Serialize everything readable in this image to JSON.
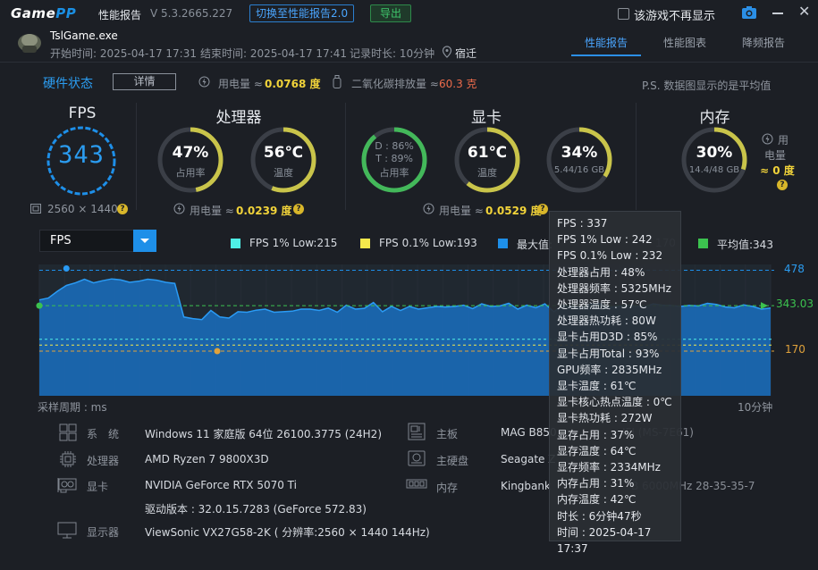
{
  "titlebar": {
    "logo_a": "Game",
    "logo_b": "PP",
    "section_title": "性能报告",
    "version": "V 5.3.2665.227",
    "switch_button": "切换至性能报告2.0",
    "export_button": "导出",
    "no_show_label": "该游戏不再显示"
  },
  "session": {
    "game_name": "TslGame.exe",
    "start": "开始时间: 2025-04-17 17:31",
    "end": "结束时间: 2025-04-17 17:41",
    "duration": "记录时长: 10分钟",
    "location": "宿迁"
  },
  "tabs": [
    {
      "label": "性能报告",
      "active": true
    },
    {
      "label": "性能图表",
      "active": false
    },
    {
      "label": "降频报告",
      "active": false
    }
  ],
  "hardware_status": {
    "title": "硬件状态",
    "detail_button": "详情",
    "power_label": "用电量 ≈",
    "power_value": "0.0768 度",
    "co2_label": "二氧化碳排放量 ≈",
    "co2_value": "60.3 克",
    "note": "P.S. 数据图显示的是平均值"
  },
  "fps_card": {
    "title": "FPS",
    "value": "343",
    "resolution": "2560 × 1440",
    "fraction": 0.97
  },
  "cpu_card": {
    "title": "处理器",
    "usage_value": "47%",
    "usage_label": "占用率",
    "usage_fraction": 0.47,
    "temp_value": "56℃",
    "temp_label": "温度",
    "temp_fraction": 0.56,
    "power_label": "用电量 ≈",
    "power_value": "0.0239 度"
  },
  "gpu_card": {
    "title": "显卡",
    "d_line": "D : 86%",
    "t_line": "T : 89%",
    "usage_label": "占用率",
    "usage_fraction": 0.89,
    "temp_value": "61℃",
    "temp_label": "温度",
    "temp_fraction": 0.61,
    "mem_value": "34%",
    "mem_sub": "5.44/16 GB",
    "mem_fraction": 0.34,
    "power_label": "用电量 ≈",
    "power_value": "0.0529 度"
  },
  "memory_card": {
    "title": "内存",
    "value": "30%",
    "sub": "14.4/48 GB",
    "fraction": 0.3,
    "power_label_1": "用",
    "power_label_2": "电量",
    "power_value": "≈ 0 度"
  },
  "chart_controls": {
    "metric_select": "FPS",
    "legend": [
      {
        "label": "FPS 1% Low:215",
        "color": "#4ff0e6"
      },
      {
        "label": "FPS 0.1% Low:193",
        "color": "#f5e94c"
      },
      {
        "label": "最大值:",
        "color": "#1e8fe8"
      },
      {
        "label": "170",
        "color": ""
      },
      {
        "label": "平均值:343",
        "color": "#3cc24f"
      }
    ]
  },
  "chart_data": {
    "type": "area",
    "series": [
      {
        "name": "FPS",
        "values": [
          365,
          372,
          398,
          420,
          430,
          444,
          430,
          438,
          445,
          441,
          432,
          436,
          444,
          440,
          432,
          428,
          300,
          294,
          290,
          325,
          300,
          296,
          320,
          318,
          326,
          330,
          318,
          320,
          322,
          330,
          330,
          325,
          334,
          318,
          345,
          330,
          333,
          355,
          320,
          340,
          325,
          340,
          330,
          335,
          340,
          338,
          340,
          345,
          332,
          350,
          340,
          342,
          352,
          330,
          345,
          335,
          350,
          320,
          345,
          340,
          335,
          348,
          352,
          335,
          340,
          345,
          342,
          338,
          350,
          345,
          344,
          340,
          344,
          342,
          352,
          348,
          338,
          335,
          346,
          340,
          330,
          334
        ]
      }
    ],
    "ref_lines": [
      {
        "label": "478",
        "value": 478,
        "color": "#1e8fe8"
      },
      {
        "label": "343.03",
        "value": 343.03,
        "color": "#3cc24f"
      },
      {
        "label": "170",
        "value": 170,
        "color": "#e0a23b"
      }
    ],
    "ylim": [
      0,
      500
    ],
    "xlabel_left": "采样周期 : ms",
    "xlabel_right": "10分钟"
  },
  "system_info": {
    "os_label": "系　统",
    "os_value": "Windows 11 家庭版 64位 26100.3775 (24H2)",
    "cpu_label": "处理器",
    "cpu_value": "AMD Ryzen 7 9800X3D",
    "gpu_label": "显卡",
    "gpu_value": "NVIDIA GeForce RTX 5070 Ti",
    "driver_value": "驱动版本 : 32.0.15.7283 (GeForce 572.83)",
    "monitor_label": "显示器",
    "monitor_value": "ViewSonic VX27G58-2K ( 分辨率:2560 × 1440 144Hz)",
    "board_label": "主板",
    "board_value": "MAG B850",
    "board_tail": "IFI (MS-7E61)",
    "disk_label": "主硬盘",
    "disk_value": "Seagate Z",
    "mem_label": "内存",
    "mem_value": "Kingbank",
    "mem_tail": "B 6000MHz 28-35-35-7"
  },
  "tooltip": [
    "FPS : 337",
    "FPS 1% Low : 242",
    "FPS 0.1% Low : 232",
    "处理器占用 : 48%",
    "处理器频率 : 5325MHz",
    "处理器温度 : 57℃",
    "处理器热功耗 : 80W",
    "显卡占用D3D : 85%",
    "显卡占用Total : 93%",
    "GPU频率 : 2835MHz",
    "显卡温度 : 61℃",
    "显卡核心热点温度 : 0℃",
    "显卡热功耗 : 272W",
    "显存占用 : 37%",
    "显存温度 : 64℃",
    "显存频率 : 2334MHz",
    "内存占用 : 31%",
    "内存温度 : 42℃",
    "时长 : 6分钟47秒",
    "时间 : 2025-04-17 17:37"
  ]
}
